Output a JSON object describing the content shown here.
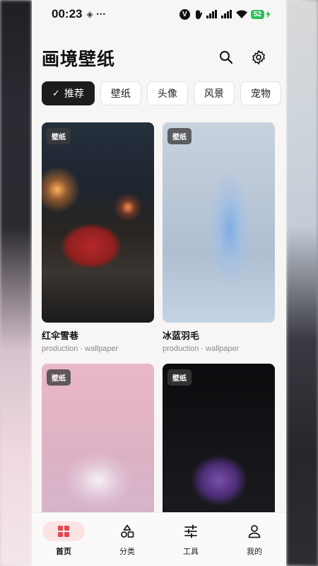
{
  "status_bar": {
    "time": "00:23",
    "left_symbols": "◈ ···",
    "battery": "52"
  },
  "header": {
    "title": "画境壁纸",
    "search_icon": "search-icon",
    "settings_icon": "gear-icon"
  },
  "chips": [
    {
      "label": "推荐",
      "active": true
    },
    {
      "label": "壁纸",
      "active": false
    },
    {
      "label": "头像",
      "active": false
    },
    {
      "label": "风景",
      "active": false
    },
    {
      "label": "宠物",
      "active": false
    }
  ],
  "cards": [
    {
      "tag": "壁纸",
      "title": "红伞雪巷",
      "sub": "production · wallpaper"
    },
    {
      "tag": "壁纸",
      "title": "冰蓝羽毛",
      "sub": "production · wallpaper"
    },
    {
      "tag": "壁纸",
      "title": "",
      "sub": ""
    },
    {
      "tag": "壁纸",
      "title": "",
      "sub": ""
    }
  ],
  "bottom_nav": [
    {
      "label": "首页",
      "icon": "grid-icon",
      "active": true
    },
    {
      "label": "分类",
      "icon": "shapes-icon",
      "active": false
    },
    {
      "label": "工具",
      "icon": "sliders-icon",
      "active": false
    },
    {
      "label": "我的",
      "icon": "user-icon",
      "active": false
    }
  ],
  "colors": {
    "accent": "#e24a4f",
    "active_chip": "#1c1c1e",
    "nav_active_bg": "#fbe3e4",
    "battery": "#2fbf5a"
  }
}
